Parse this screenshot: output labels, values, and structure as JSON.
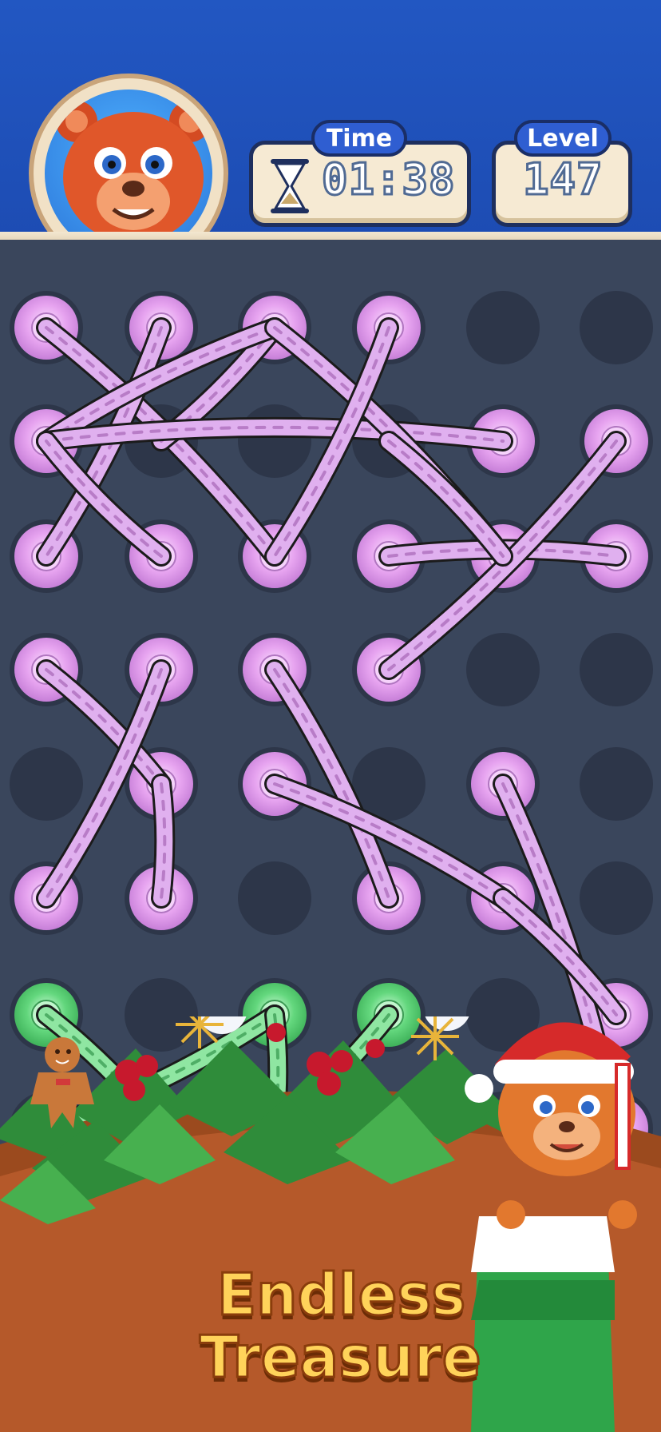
{
  "hud": {
    "time_label": "Time",
    "time_value": "01:38",
    "level_label": "Level",
    "level_value": "147"
  },
  "banner": {
    "line1": "Endless",
    "line2": "Treasure"
  },
  "colors": {
    "header_blue": "#2257c2",
    "board": "#3a465c",
    "pink_rope": "#e0b0ef",
    "green_rope": "#8fe6a2",
    "banner_text": "#ffd35a"
  },
  "icons": [
    "hourglass-icon",
    "bear-avatar",
    "gingerbread-icon",
    "snowflake-icon",
    "santa-bear-character"
  ]
}
